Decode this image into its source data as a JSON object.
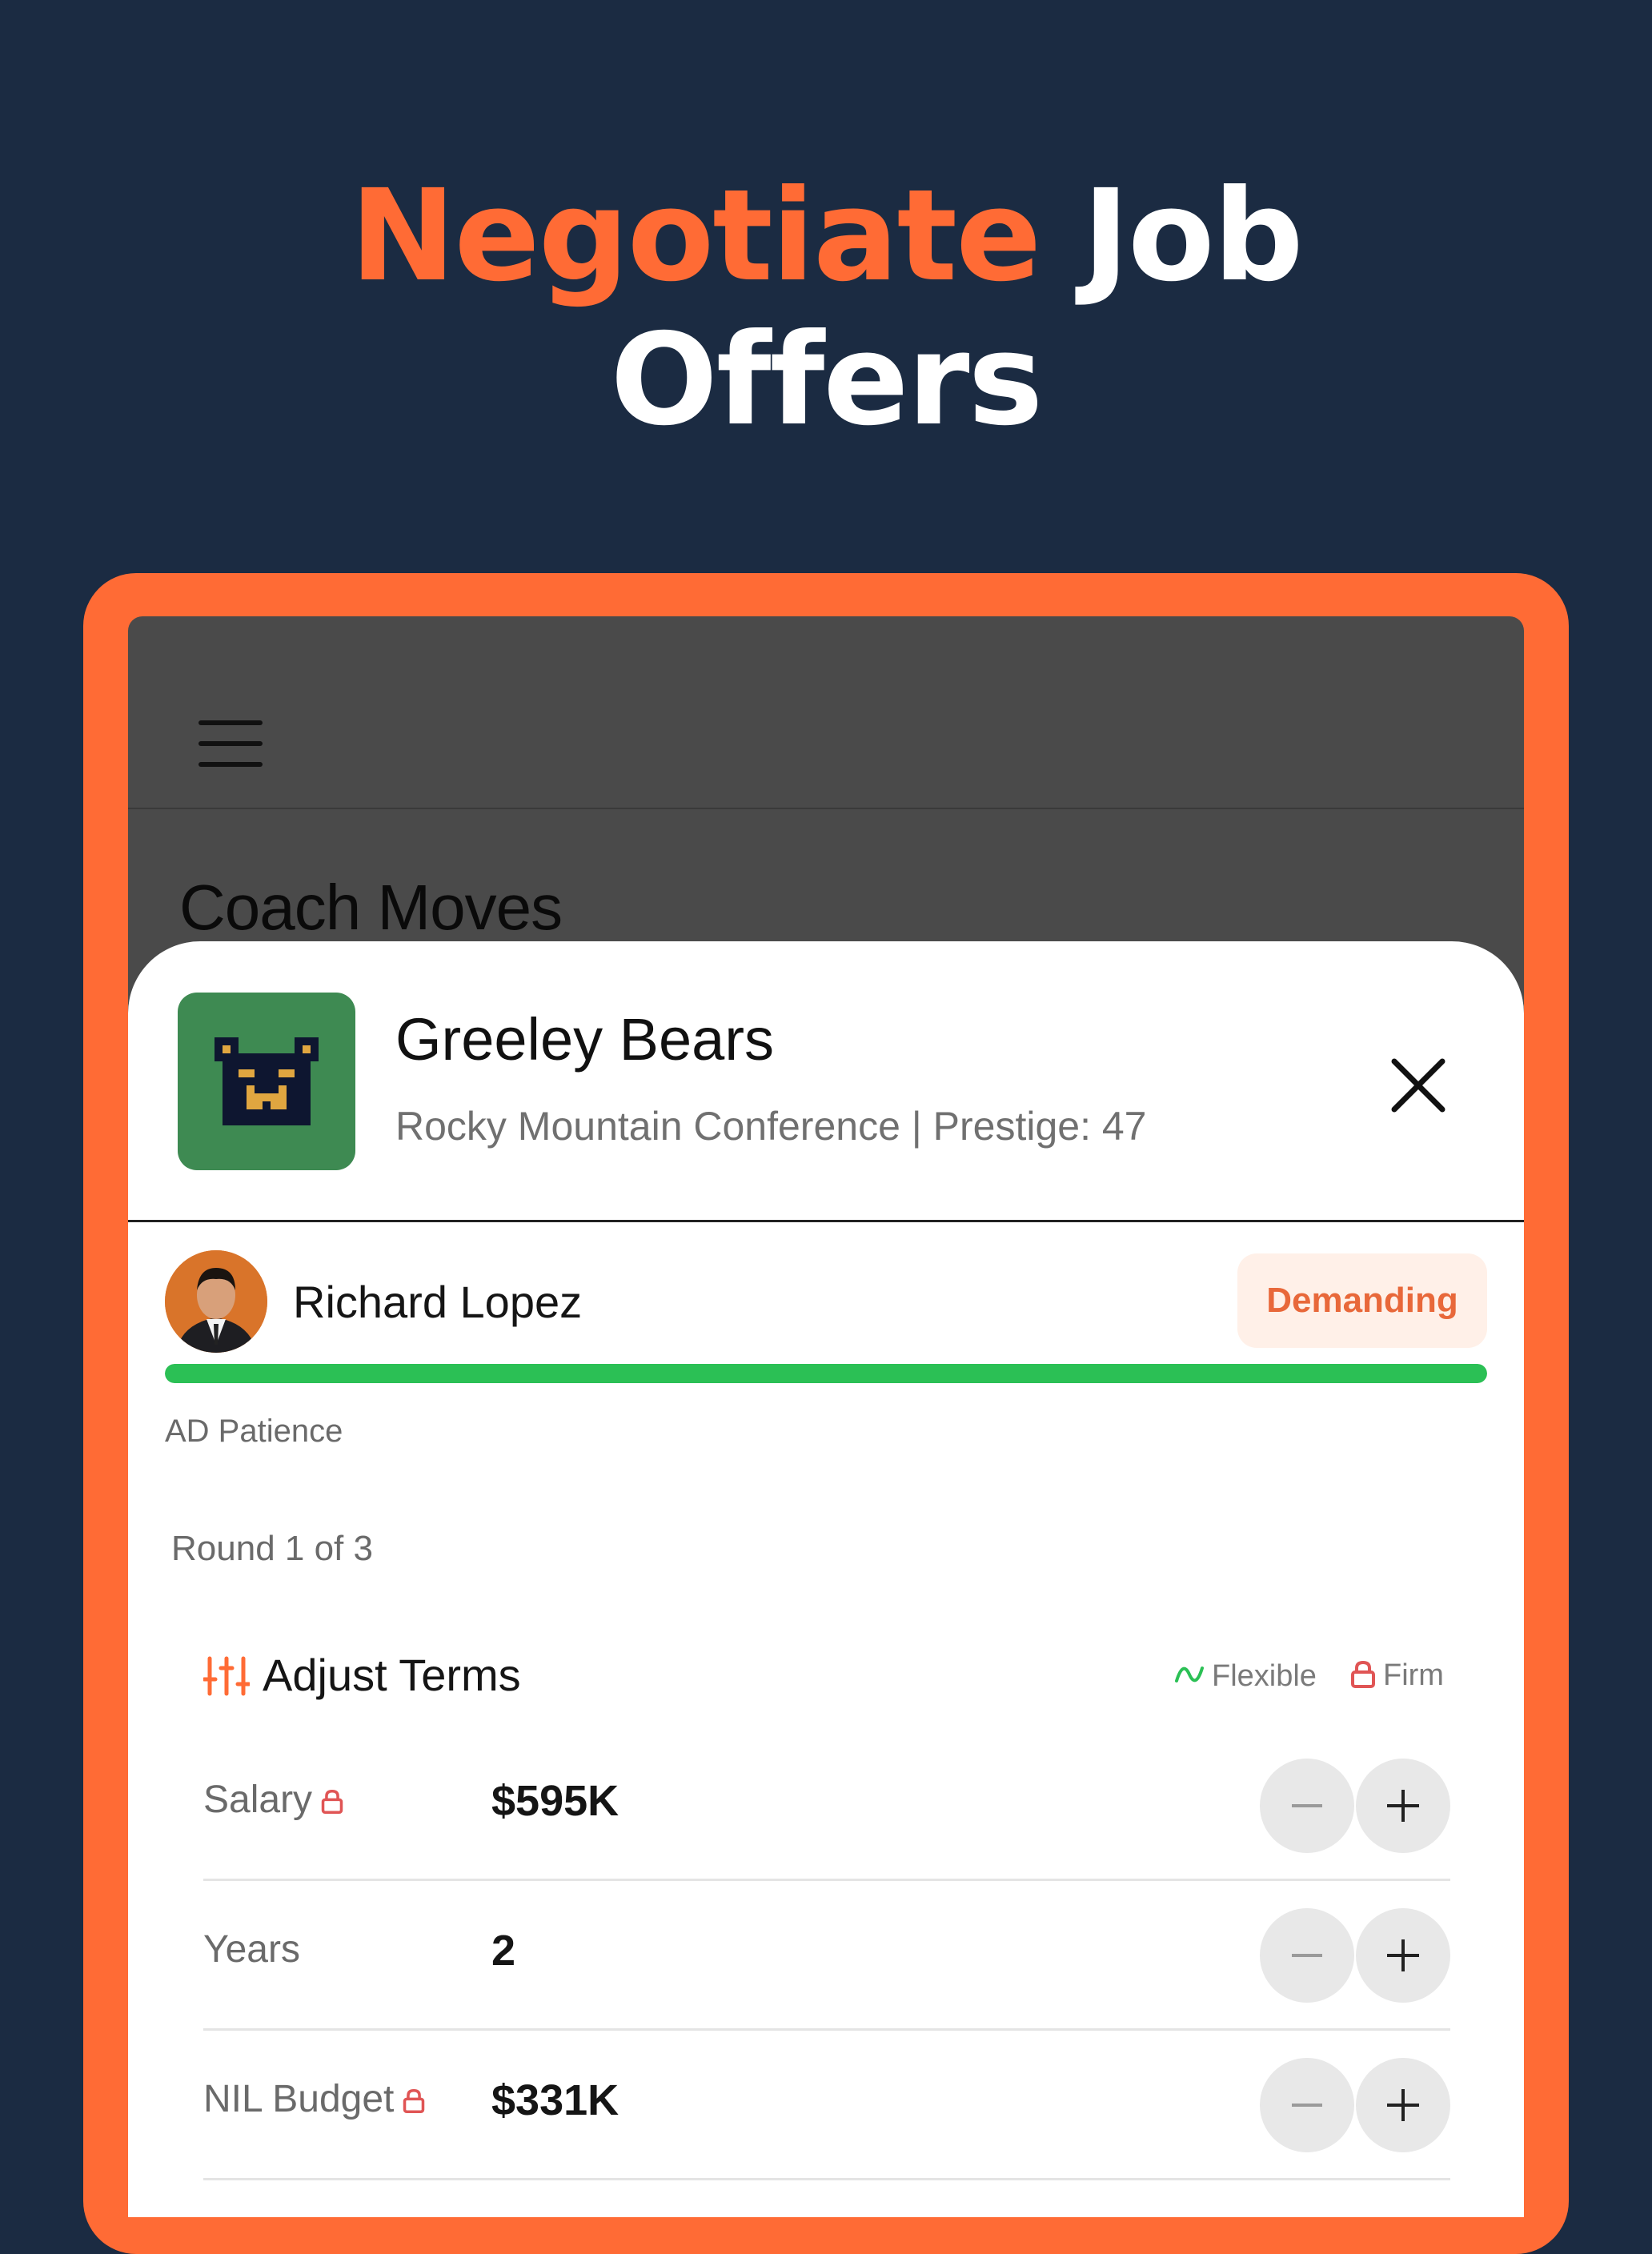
{
  "headline": {
    "accent": "Negotiate",
    "rest_line1": "Job",
    "rest_line2": "Offers"
  },
  "app": {
    "screen_title": "Coach Moves"
  },
  "team": {
    "name": "Greeley Bears",
    "subtitle": "Rocky Mountain Conference | Prestige: 47"
  },
  "athletic_director": {
    "name": "Richard Lopez",
    "mood_badge": "Demanding",
    "patience_label": "AD Patience",
    "patience": 1.0
  },
  "negotiation": {
    "round": "Round 1 of 3",
    "section_title": "Adjust Terms",
    "legend_flexible": "Flexible",
    "legend_firm": "Firm"
  },
  "terms": [
    {
      "label": "Salary",
      "value": "$595K",
      "firm": true
    },
    {
      "label": "Years",
      "value": "2",
      "firm": false
    },
    {
      "label": "NIL Budget",
      "value": "$331K",
      "firm": true
    }
  ],
  "colors": {
    "accent": "#ff6b35",
    "background": "#1b2b42",
    "patience_bar": "#2bc055",
    "badge_text": "#e8683a",
    "logo_bg": "#3e8a52"
  }
}
